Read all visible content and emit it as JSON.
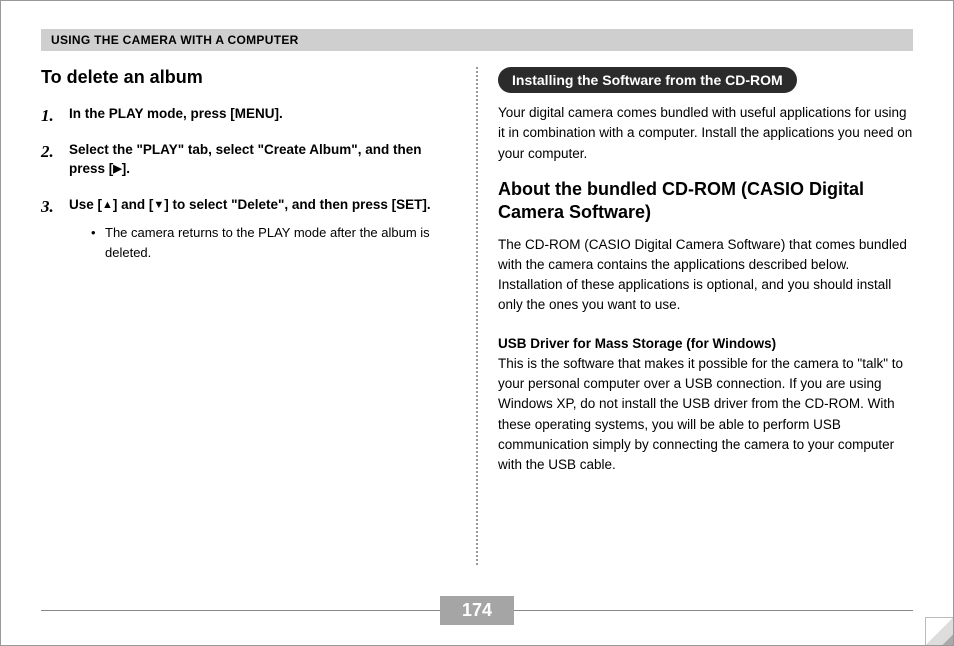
{
  "header": {
    "chapter": "USING THE CAMERA WITH A COMPUTER"
  },
  "left": {
    "title": "To delete an album",
    "steps": [
      {
        "text": "In the PLAY mode, press [MENU]."
      },
      {
        "text_pre": "Select the \"PLAY\" tab, select \"Create Album\", and then press [",
        "icon": "▶",
        "text_post": "]."
      },
      {
        "text_pre": "Use [",
        "icon1": "▲",
        "mid": "] and [",
        "icon2": "▼",
        "text_post": "] to select \"Delete\", and then press [SET].",
        "sub": "The camera returns to the PLAY mode after the album is deleted."
      }
    ]
  },
  "right": {
    "pill": "Installing the Software from the CD-ROM",
    "intro": "Your digital camera comes bundled with useful applications for using it in combination with a computer. Install the applications you need on your computer.",
    "subheading": "About the bundled CD-ROM (CASIO Digital Camera Software)",
    "para1": "The CD-ROM (CASIO Digital Camera Software) that comes bundled with the camera contains the applications described below. Installation of these applications is optional, and you should install only the ones you want to use.",
    "usb_title": "USB Driver for Mass Storage (for Windows)",
    "usb_body": "This is the software that makes it possible for the camera to \"talk\" to your personal computer over a USB connection. If you are using Windows XP, do not install the USB driver from the CD-ROM. With these operating systems, you will be able to perform USB communication simply by connecting the camera to your computer with the USB cable."
  },
  "page_number": "174"
}
